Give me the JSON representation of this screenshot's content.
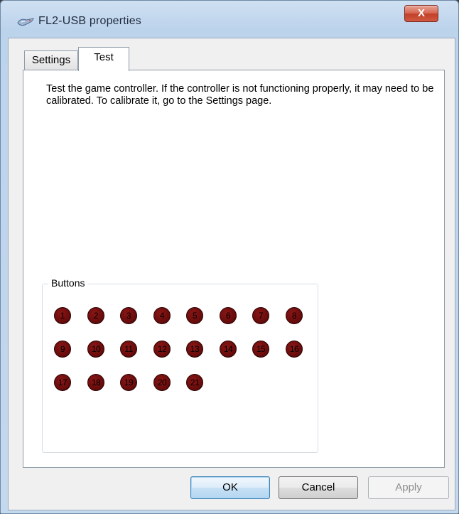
{
  "window": {
    "title": "FL2-USB properties",
    "close_label": "X"
  },
  "tabs": [
    {
      "label": "Settings",
      "selected": false
    },
    {
      "label": "Test",
      "selected": true
    }
  ],
  "test_page": {
    "description": "Test the game controller.  If the controller is not functioning properly, it may need to be calibrated.  To calibrate it, go to the Settings page.",
    "buttons_group_label": "Buttons",
    "buttons": [
      "1",
      "2",
      "3",
      "4",
      "5",
      "6",
      "7",
      "8",
      "9",
      "10",
      "11",
      "12",
      "13",
      "14",
      "15",
      "16",
      "17",
      "18",
      "19",
      "20",
      "21"
    ]
  },
  "footer": {
    "ok_label": "OK",
    "cancel_label": "Cancel",
    "apply_label": "Apply",
    "apply_enabled": false
  },
  "colors": {
    "button_indicator": "#6b0c0c",
    "close_button": "#c2402a"
  },
  "icons": {
    "app": "game-controller-icon",
    "close": "close-icon"
  }
}
